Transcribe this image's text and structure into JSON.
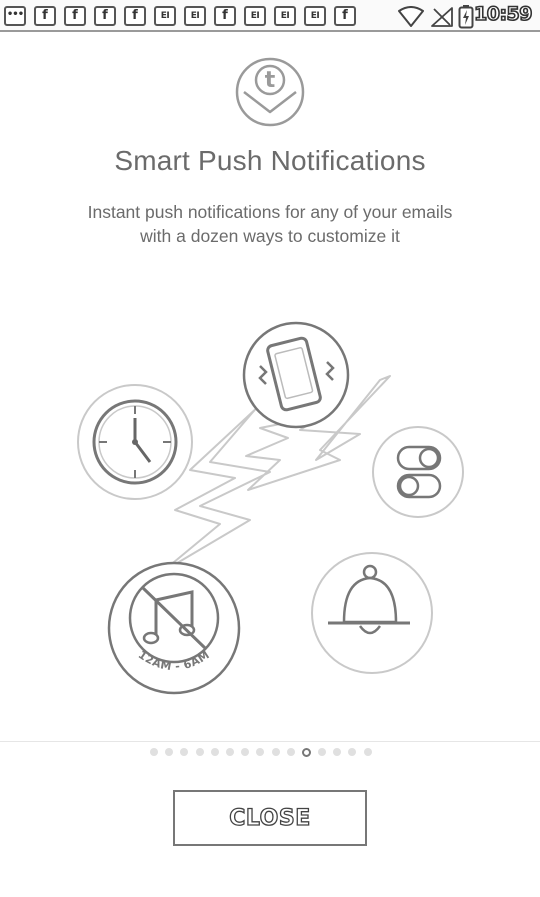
{
  "status_bar": {
    "notification_icons": [
      {
        "icon": "more-dots-icon",
        "glyph": "•••"
      },
      {
        "icon": "facebook-icon",
        "glyph": "f"
      },
      {
        "icon": "facebook-icon",
        "glyph": "f"
      },
      {
        "icon": "facebook-icon",
        "glyph": "f"
      },
      {
        "icon": "facebook-icon",
        "glyph": "f"
      },
      {
        "icon": "email-icon",
        "glyph": "EI"
      },
      {
        "icon": "email-icon",
        "glyph": "EI"
      },
      {
        "icon": "facebook-icon",
        "glyph": "f"
      },
      {
        "icon": "email-icon",
        "glyph": "EI"
      },
      {
        "icon": "email-icon",
        "glyph": "EI"
      },
      {
        "icon": "email-icon",
        "glyph": "EI"
      },
      {
        "icon": "facebook-icon",
        "glyph": "f"
      }
    ],
    "system_icons": [
      "wifi-icon",
      "no-signal-icon",
      "battery-charging-icon"
    ],
    "time": "10:59"
  },
  "onboarding": {
    "logo_letter": "t",
    "title": "Smart Push Notifications",
    "subtitle_line1": "Instant push notifications for any of your emails",
    "subtitle_line2": "with a dozen ways to customize it",
    "illustration": {
      "quiet_hours_label": "12AM - 6AM",
      "icons": [
        "clock-icon",
        "vibrating-phone-icon",
        "toggle-icon",
        "bell-icon",
        "muted-music-icon",
        "lightning-bolt-icon"
      ]
    },
    "page_indicator": {
      "total": 15,
      "current_index": 10
    },
    "close_label": "CLOSE"
  },
  "colors": {
    "outline": "#777777",
    "background": "#ffffff",
    "text": "#6b6b6b"
  }
}
